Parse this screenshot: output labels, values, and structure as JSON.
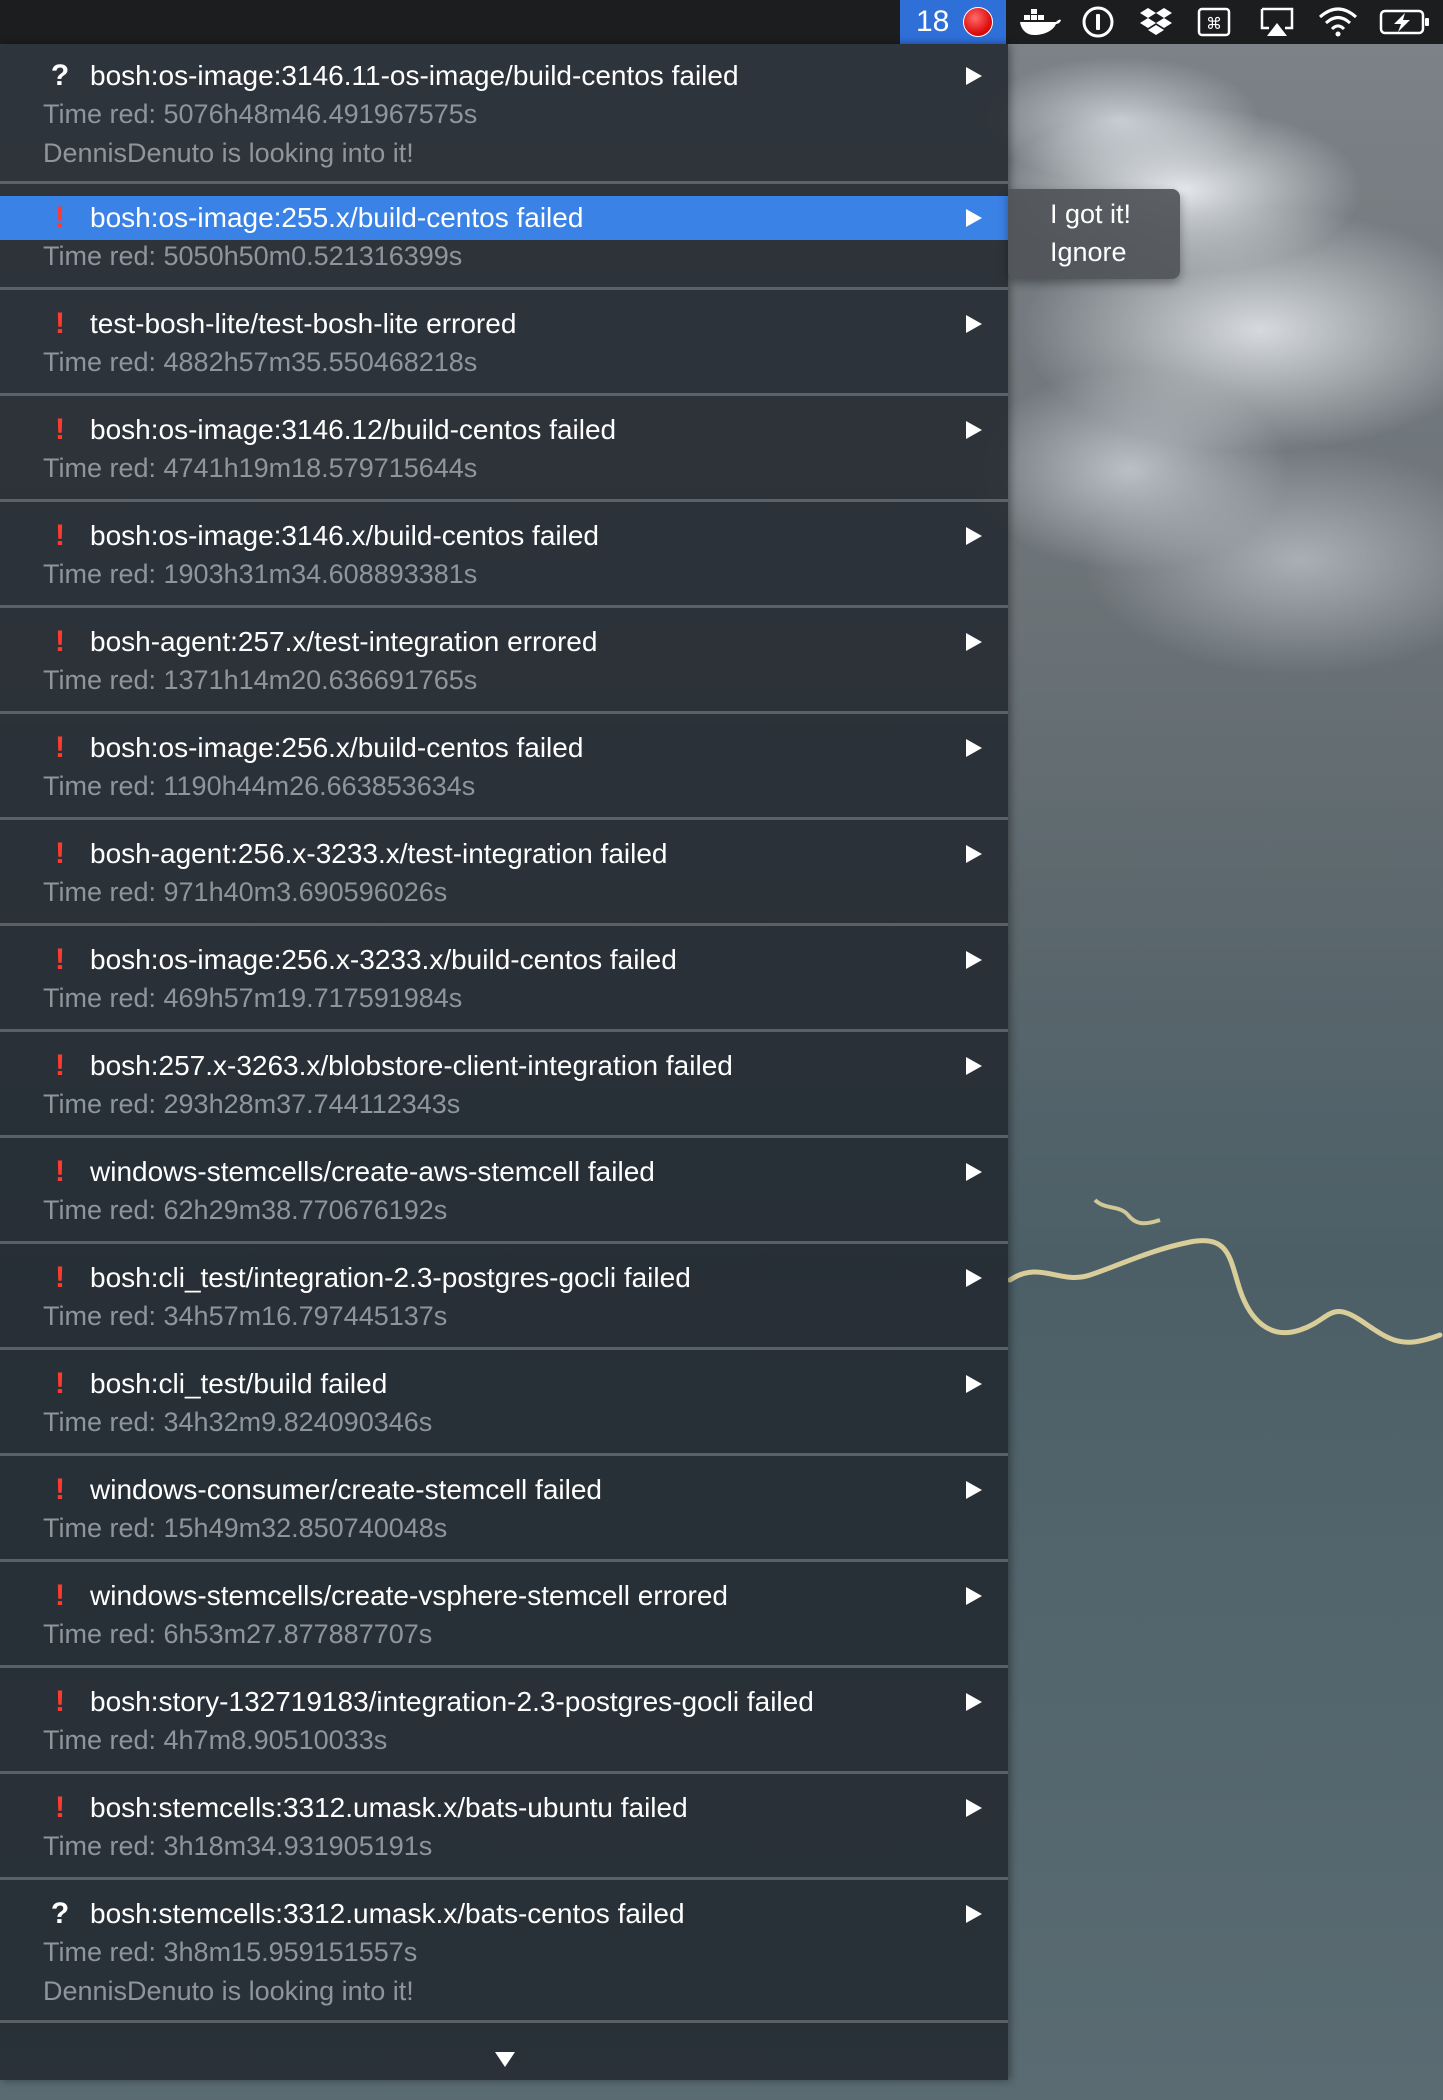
{
  "menubar": {
    "status_count": "18",
    "tray_icons": [
      "docker-icon",
      "onepassword-icon",
      "dropbox-icon",
      "command-key-icon",
      "airplay-icon",
      "wifi-icon",
      "battery-charging-icon"
    ]
  },
  "menu": {
    "items": [
      {
        "status": "question",
        "glyph": "?",
        "title": "bosh:os-image:3146.11-os-image/build-centos failed",
        "time": "Time red: 5076h48m46.491967575s",
        "note": "DennisDenuto is looking into it!"
      },
      {
        "status": "error",
        "glyph": "!",
        "title": "bosh:os-image:255.x/build-centos failed",
        "time": "Time red: 5050h50m0.521316399s",
        "highlighted": true
      },
      {
        "status": "error",
        "glyph": "!",
        "title": "test-bosh-lite/test-bosh-lite errored",
        "time": "Time red: 4882h57m35.550468218s"
      },
      {
        "status": "error",
        "glyph": "!",
        "title": "bosh:os-image:3146.12/build-centos failed",
        "time": "Time red: 4741h19m18.579715644s"
      },
      {
        "status": "error",
        "glyph": "!",
        "title": "bosh:os-image:3146.x/build-centos failed",
        "time": "Time red: 1903h31m34.608893381s"
      },
      {
        "status": "error",
        "glyph": "!",
        "title": "bosh-agent:257.x/test-integration errored",
        "time": "Time red: 1371h14m20.636691765s"
      },
      {
        "status": "error",
        "glyph": "!",
        "title": "bosh:os-image:256.x/build-centos failed",
        "time": "Time red: 1190h44m26.663853634s"
      },
      {
        "status": "error",
        "glyph": "!",
        "title": "bosh-agent:256.x-3233.x/test-integration failed",
        "time": "Time red: 971h40m3.690596026s"
      },
      {
        "status": "error",
        "glyph": "!",
        "title": "bosh:os-image:256.x-3233.x/build-centos failed",
        "time": "Time red: 469h57m19.717591984s"
      },
      {
        "status": "error",
        "glyph": "!",
        "title": "bosh:257.x-3263.x/blobstore-client-integration failed",
        "time": "Time red: 293h28m37.744112343s"
      },
      {
        "status": "error",
        "glyph": "!",
        "title": "windows-stemcells/create-aws-stemcell failed",
        "time": "Time red: 62h29m38.770676192s"
      },
      {
        "status": "error",
        "glyph": "!",
        "title": "bosh:cli_test/integration-2.3-postgres-gocli failed",
        "time": "Time red: 34h57m16.797445137s"
      },
      {
        "status": "error",
        "glyph": "!",
        "title": "bosh:cli_test/build failed",
        "time": "Time red: 34h32m9.824090346s"
      },
      {
        "status": "error",
        "glyph": "!",
        "title": "windows-consumer/create-stemcell failed",
        "time": "Time red: 15h49m32.850740048s"
      },
      {
        "status": "error",
        "glyph": "!",
        "title": "windows-stemcells/create-vsphere-stemcell errored",
        "time": "Time red: 6h53m27.877887707s"
      },
      {
        "status": "error",
        "glyph": "!",
        "title": "bosh:story-132719183/integration-2.3-postgres-gocli failed",
        "time": "Time red: 4h7m8.90510033s"
      },
      {
        "status": "error",
        "glyph": "!",
        "title": "bosh:stemcells:3312.umask.x/bats-ubuntu failed",
        "time": "Time red: 3h18m34.931905191s"
      },
      {
        "status": "question",
        "glyph": "?",
        "title": "bosh:stemcells:3312.umask.x/bats-centos failed",
        "time": "Time red: 3h8m15.959151557s",
        "note": "DennisDenuto is looking into it!"
      }
    ]
  },
  "submenu": {
    "items": [
      "I got it!",
      "Ignore"
    ]
  },
  "colors": {
    "highlight": "#3b82e6",
    "error_glyph": "#ff3b30",
    "status_item": "#2f6fd8",
    "status_dot": "#e01010",
    "subtext": "#8e959c"
  }
}
